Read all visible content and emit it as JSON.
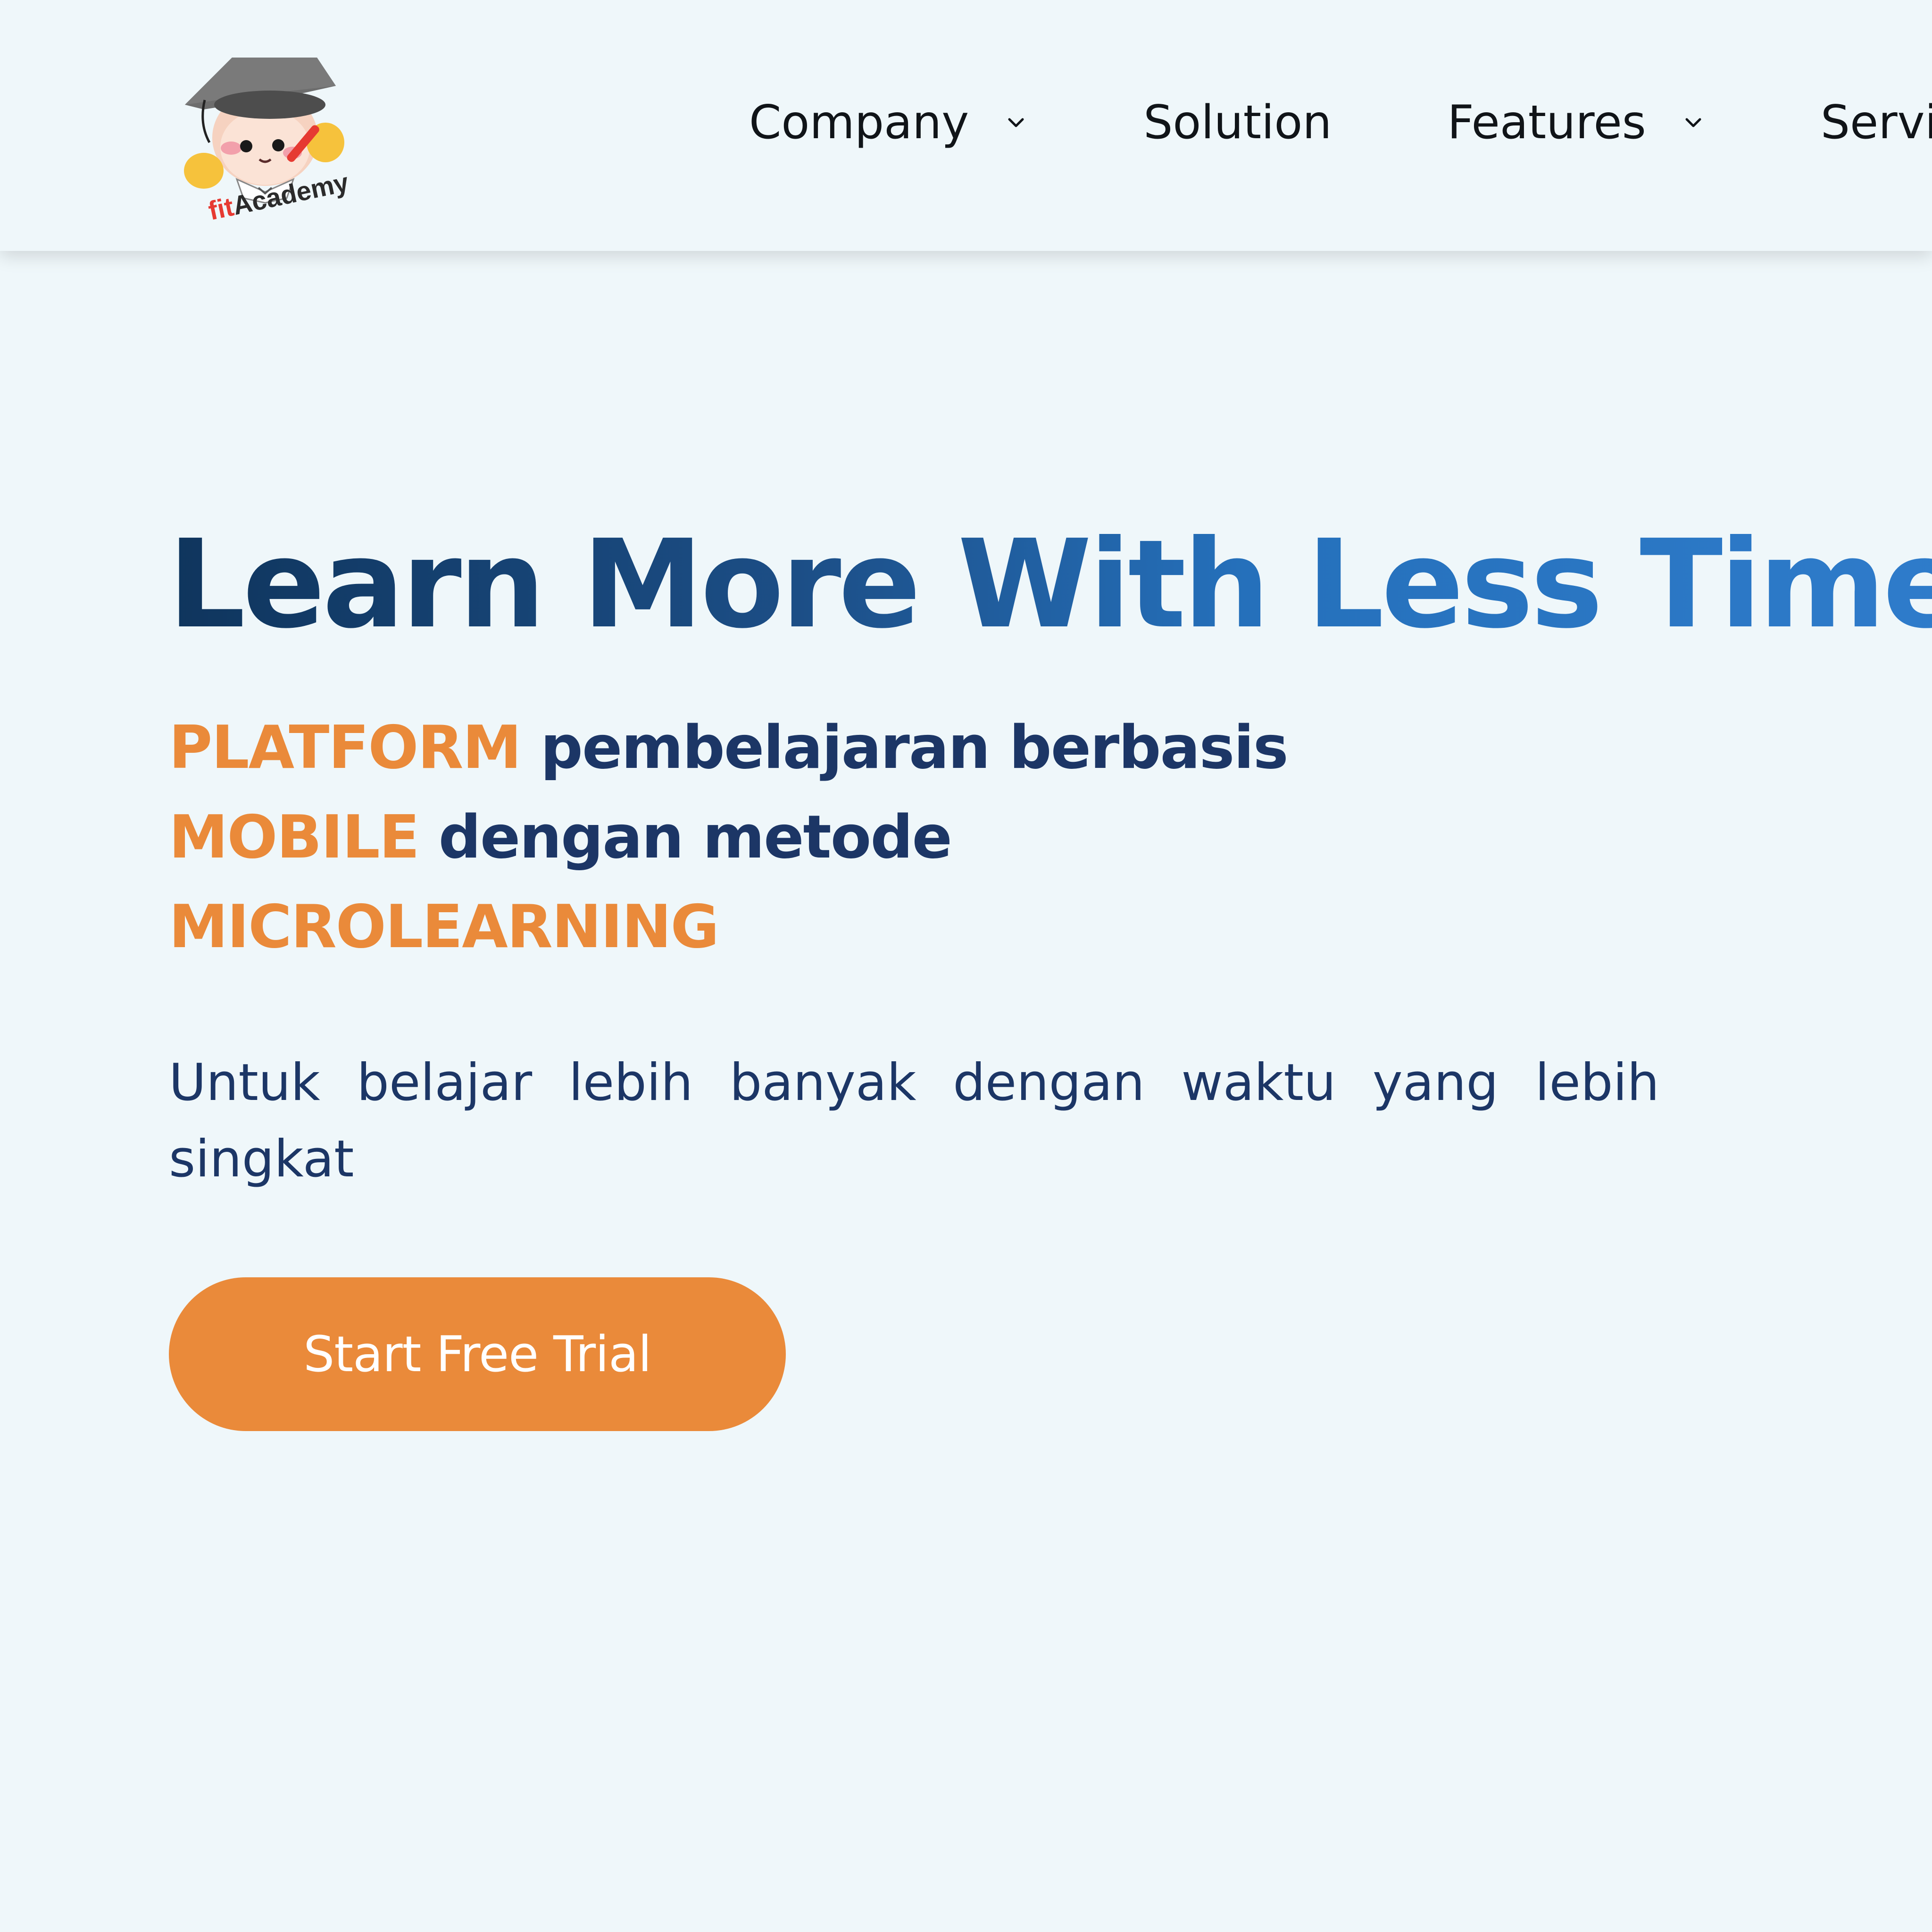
{
  "header": {
    "logo_text": "fitAcademy",
    "nav": {
      "company": "Company",
      "solution": "Solution",
      "features": "Features",
      "services": "Services"
    }
  },
  "hero": {
    "title": "Learn More With Less Time",
    "tagline": {
      "line1_highlight": "PLATFORM",
      "line1_rest": "pembelajaran berbasis",
      "line2_highlight": "MOBILE",
      "line2_rest": "dengan metode",
      "line3_highlight": "MICROLEARNING"
    },
    "subtext": "Untuk belajar lebih banyak dengan waktu yang lebih singkat",
    "cta_label": "Start Free Trial"
  },
  "colors": {
    "background": "#eff7fa",
    "accent_orange": "#ea8a3a",
    "navy": "#1c3666",
    "title_dark": "#0f355d",
    "title_blue": "#2f7ccb"
  },
  "icons": {
    "logo": "fitacademy-mascot-logo",
    "dropdown": "chevron-down-icon"
  }
}
